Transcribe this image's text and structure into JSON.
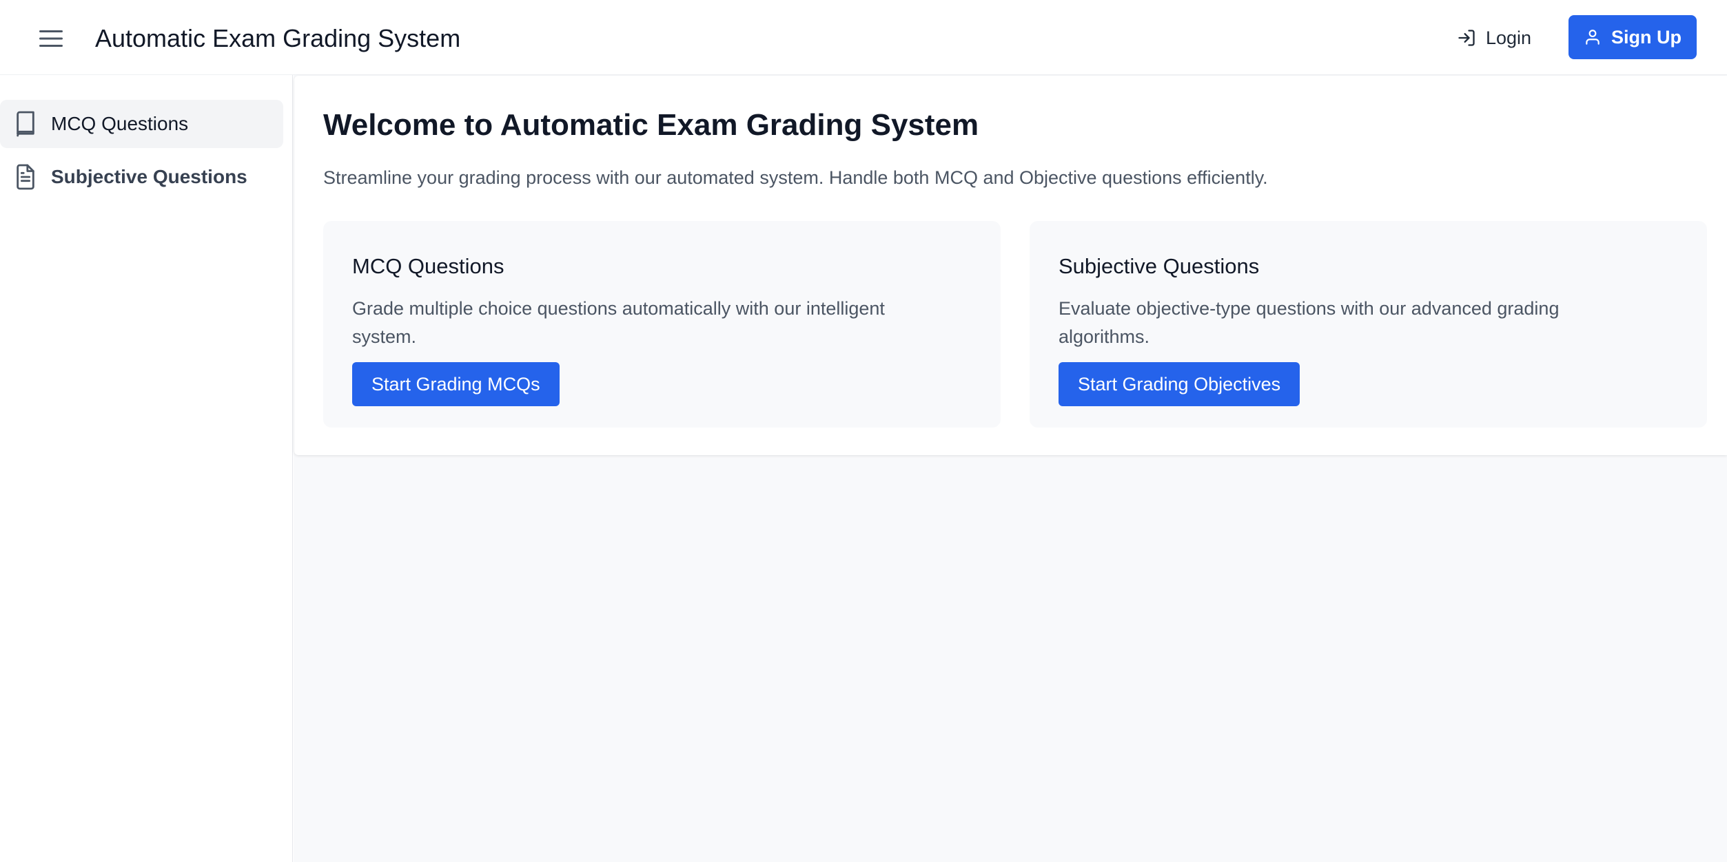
{
  "header": {
    "title": "Automatic Exam Grading System",
    "login_label": "Login",
    "signup_label": "Sign Up"
  },
  "sidebar": {
    "items": [
      {
        "label": "MCQ Questions",
        "icon": "book-icon",
        "active": true
      },
      {
        "label": "Subjective Questions",
        "icon": "document-icon",
        "active": false
      }
    ]
  },
  "main": {
    "title": "Welcome to Automatic Exam Grading System",
    "subtitle": "Streamline your grading process with our automated system. Handle both MCQ and Objective questions efficiently.",
    "cards": [
      {
        "title": "MCQ Questions",
        "description": "Grade multiple choice questions automatically with our intelligent system.",
        "button_label": "Start Grading MCQs"
      },
      {
        "title": "Subjective Questions",
        "description": "Evaluate objective-type questions with our advanced grading algorithms.",
        "button_label": "Start Grading Objectives"
      }
    ]
  },
  "colors": {
    "primary": "#2563eb",
    "background": "#f8f9fb",
    "text": "#111827",
    "muted_text": "#4b5563"
  }
}
